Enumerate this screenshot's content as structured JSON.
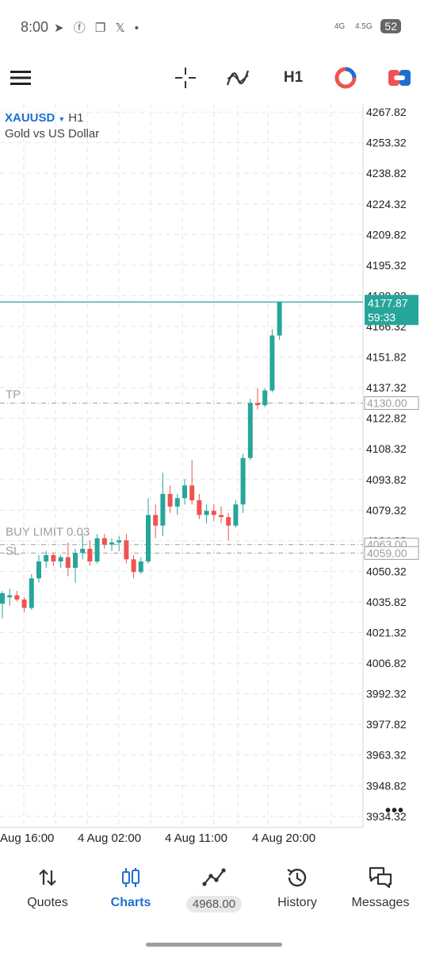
{
  "status_bar": {
    "time": "8:00",
    "icons": "➤ ⓕ ❐ 𝕏 •",
    "net1": "4G",
    "net2": "4.5G",
    "battery": "52"
  },
  "toolbar": {
    "timeframe_label": "H1"
  },
  "symbol": {
    "name": "XAUUSD",
    "timeframe": "H1",
    "description": "Gold vs US Dollar"
  },
  "chart_data": {
    "type": "candlestick",
    "price_axis": {
      "ticks": [
        "4267.82",
        "4253.32",
        "4238.82",
        "4224.32",
        "4209.82",
        "4195.32",
        "4180.82",
        "4166.32",
        "4151.82",
        "4137.32",
        "4122.82",
        "4108.32",
        "4093.82",
        "4079.32",
        "4064.82",
        "4050.32",
        "4035.82",
        "4021.32",
        "4006.82",
        "3992.32",
        "3977.82",
        "3963.32",
        "3948.82",
        "3934.32"
      ],
      "range": [
        3929,
        4272
      ]
    },
    "time_axis": {
      "labels": [
        "Aug 16:00",
        "4 Aug 02:00",
        "4 Aug 11:00",
        "4 Aug 20:00"
      ]
    },
    "current_price": {
      "value": 4177.87,
      "label": "4177.87",
      "countdown": "59:33",
      "color": "#26a69a"
    },
    "levels": [
      {
        "name": "TP",
        "label": "TP",
        "price": 4130.0,
        "price_label": "4130.00"
      },
      {
        "name": "BUY LIMIT",
        "label": "BUY LIMIT 0.03",
        "price": 4063.0,
        "price_label": "4063.00"
      },
      {
        "name": "SL",
        "label": "SL",
        "price": 4059.0,
        "price_label": "4059.00"
      }
    ],
    "colors": {
      "up": "#26a69a",
      "down": "#ef5350",
      "grid": "#e6e6e6",
      "level": "#9e9e9e"
    },
    "candles": [
      {
        "o": 4035,
        "h": 4041,
        "l": 4028,
        "c": 4040
      },
      {
        "o": 4038,
        "h": 4042,
        "l": 4034,
        "c": 4039
      },
      {
        "o": 4039,
        "h": 4041,
        "l": 4036,
        "c": 4037
      },
      {
        "o": 4037,
        "h": 4038,
        "l": 4031,
        "c": 4033
      },
      {
        "o": 4033,
        "h": 4049,
        "l": 4032,
        "c": 4047
      },
      {
        "o": 4047,
        "h": 4058,
        "l": 4045,
        "c": 4055
      },
      {
        "o": 4055,
        "h": 4060,
        "l": 4052,
        "c": 4058
      },
      {
        "o": 4058,
        "h": 4059,
        "l": 4053,
        "c": 4055
      },
      {
        "o": 4055,
        "h": 4058,
        "l": 4052,
        "c": 4057
      },
      {
        "o": 4057,
        "h": 4064,
        "l": 4048,
        "c": 4052
      },
      {
        "o": 4052,
        "h": 4061,
        "l": 4045,
        "c": 4059
      },
      {
        "o": 4059,
        "h": 4068,
        "l": 4056,
        "c": 4061
      },
      {
        "o": 4061,
        "h": 4065,
        "l": 4053,
        "c": 4055
      },
      {
        "o": 4055,
        "h": 4068,
        "l": 4054,
        "c": 4066
      },
      {
        "o": 4066,
        "h": 4068,
        "l": 4061,
        "c": 4063
      },
      {
        "o": 4063,
        "h": 4066,
        "l": 4060,
        "c": 4064
      },
      {
        "o": 4064,
        "h": 4067,
        "l": 4060,
        "c": 4065
      },
      {
        "o": 4065,
        "h": 4068,
        "l": 4054,
        "c": 4056
      },
      {
        "o": 4056,
        "h": 4058,
        "l": 4047,
        "c": 4050
      },
      {
        "o": 4050,
        "h": 4057,
        "l": 4049,
        "c": 4055
      },
      {
        "o": 4055,
        "h": 4085,
        "l": 4054,
        "c": 4077
      },
      {
        "o": 4077,
        "h": 4082,
        "l": 4066,
        "c": 4072
      },
      {
        "o": 4072,
        "h": 4097,
        "l": 4067,
        "c": 4087
      },
      {
        "o": 4087,
        "h": 4091,
        "l": 4078,
        "c": 4081
      },
      {
        "o": 4081,
        "h": 4087,
        "l": 4077,
        "c": 4085
      },
      {
        "o": 4085,
        "h": 4094,
        "l": 4082,
        "c": 4091
      },
      {
        "o": 4091,
        "h": 4103,
        "l": 4082,
        "c": 4084
      },
      {
        "o": 4084,
        "h": 4087,
        "l": 4075,
        "c": 4077
      },
      {
        "o": 4077,
        "h": 4082,
        "l": 4073,
        "c": 4079
      },
      {
        "o": 4079,
        "h": 4082,
        "l": 4074,
        "c": 4077
      },
      {
        "o": 4077,
        "h": 4081,
        "l": 4073,
        "c": 4076
      },
      {
        "o": 4076,
        "h": 4078,
        "l": 4065,
        "c": 4072
      },
      {
        "o": 4072,
        "h": 4084,
        "l": 4071,
        "c": 4082
      },
      {
        "o": 4082,
        "h": 4106,
        "l": 4078,
        "c": 4104
      },
      {
        "o": 4104,
        "h": 4132,
        "l": 4103,
        "c": 4130
      },
      {
        "o": 4130,
        "h": 4137,
        "l": 4127,
        "c": 4129
      },
      {
        "o": 4129,
        "h": 4137,
        "l": 4128,
        "c": 4136
      },
      {
        "o": 4136,
        "h": 4165,
        "l": 4135,
        "c": 4162
      },
      {
        "o": 4162,
        "h": 4178,
        "l": 4160,
        "c": 4177.87
      }
    ]
  },
  "nav": {
    "items": [
      {
        "label": "Quotes",
        "icon": "quotes-arrows-icon"
      },
      {
        "label": "Charts",
        "icon": "charts-candles-icon",
        "active": true
      },
      {
        "label": "4968.00",
        "icon": "trade-line-icon"
      },
      {
        "label": "History",
        "icon": "history-clock-icon"
      },
      {
        "label": "Messages",
        "icon": "messages-bubbles-icon"
      }
    ]
  }
}
